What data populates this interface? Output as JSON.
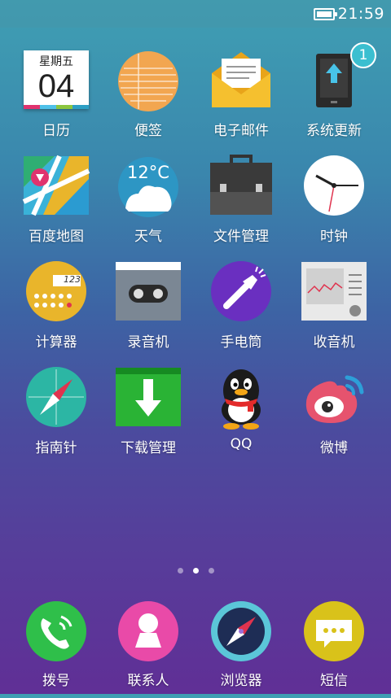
{
  "status_bar": {
    "time": "21:59",
    "battery_icon": "battery-full-icon"
  },
  "apps": [
    {
      "label": "日历",
      "icon": "calendar-icon",
      "weekday": "星期五",
      "day": "04"
    },
    {
      "label": "便签",
      "icon": "notes-icon"
    },
    {
      "label": "电子邮件",
      "icon": "email-icon"
    },
    {
      "label": "系统更新",
      "icon": "system-update-icon",
      "badge": "1"
    },
    {
      "label": "百度地图",
      "icon": "map-icon"
    },
    {
      "label": "天气",
      "icon": "weather-icon",
      "temperature": "12°C"
    },
    {
      "label": "文件管理",
      "icon": "briefcase-icon"
    },
    {
      "label": "时钟",
      "icon": "clock-icon"
    },
    {
      "label": "计算器",
      "icon": "calculator-icon",
      "display": "123"
    },
    {
      "label": "录音机",
      "icon": "recorder-icon"
    },
    {
      "label": "手电筒",
      "icon": "flashlight-icon"
    },
    {
      "label": "收音机",
      "icon": "radio-icon"
    },
    {
      "label": "指南针",
      "icon": "compass-icon"
    },
    {
      "label": "下载管理",
      "icon": "download-icon"
    },
    {
      "label": "QQ",
      "icon": "qq-penguin-icon"
    },
    {
      "label": "微博",
      "icon": "weibo-icon"
    }
  ],
  "page_indicator": {
    "count": 3,
    "active": 2
  },
  "dock": [
    {
      "label": "拨号",
      "icon": "phone-icon"
    },
    {
      "label": "联系人",
      "icon": "contacts-icon"
    },
    {
      "label": "浏览器",
      "icon": "browser-icon"
    },
    {
      "label": "短信",
      "icon": "messages-icon"
    }
  ],
  "colors": {
    "calendar_stripe": [
      "#e0336e",
      "#4fc1e9",
      "#8cc63f",
      "#2d9fc4"
    ],
    "badge": "#3bbfd0",
    "download_green": "#2ab335",
    "flashlight_purple": "#6a2fc0",
    "phone_green": "#2fbf4a",
    "contacts_pink": "#e94aa8",
    "messages_yellow": "#d9c21a"
  }
}
